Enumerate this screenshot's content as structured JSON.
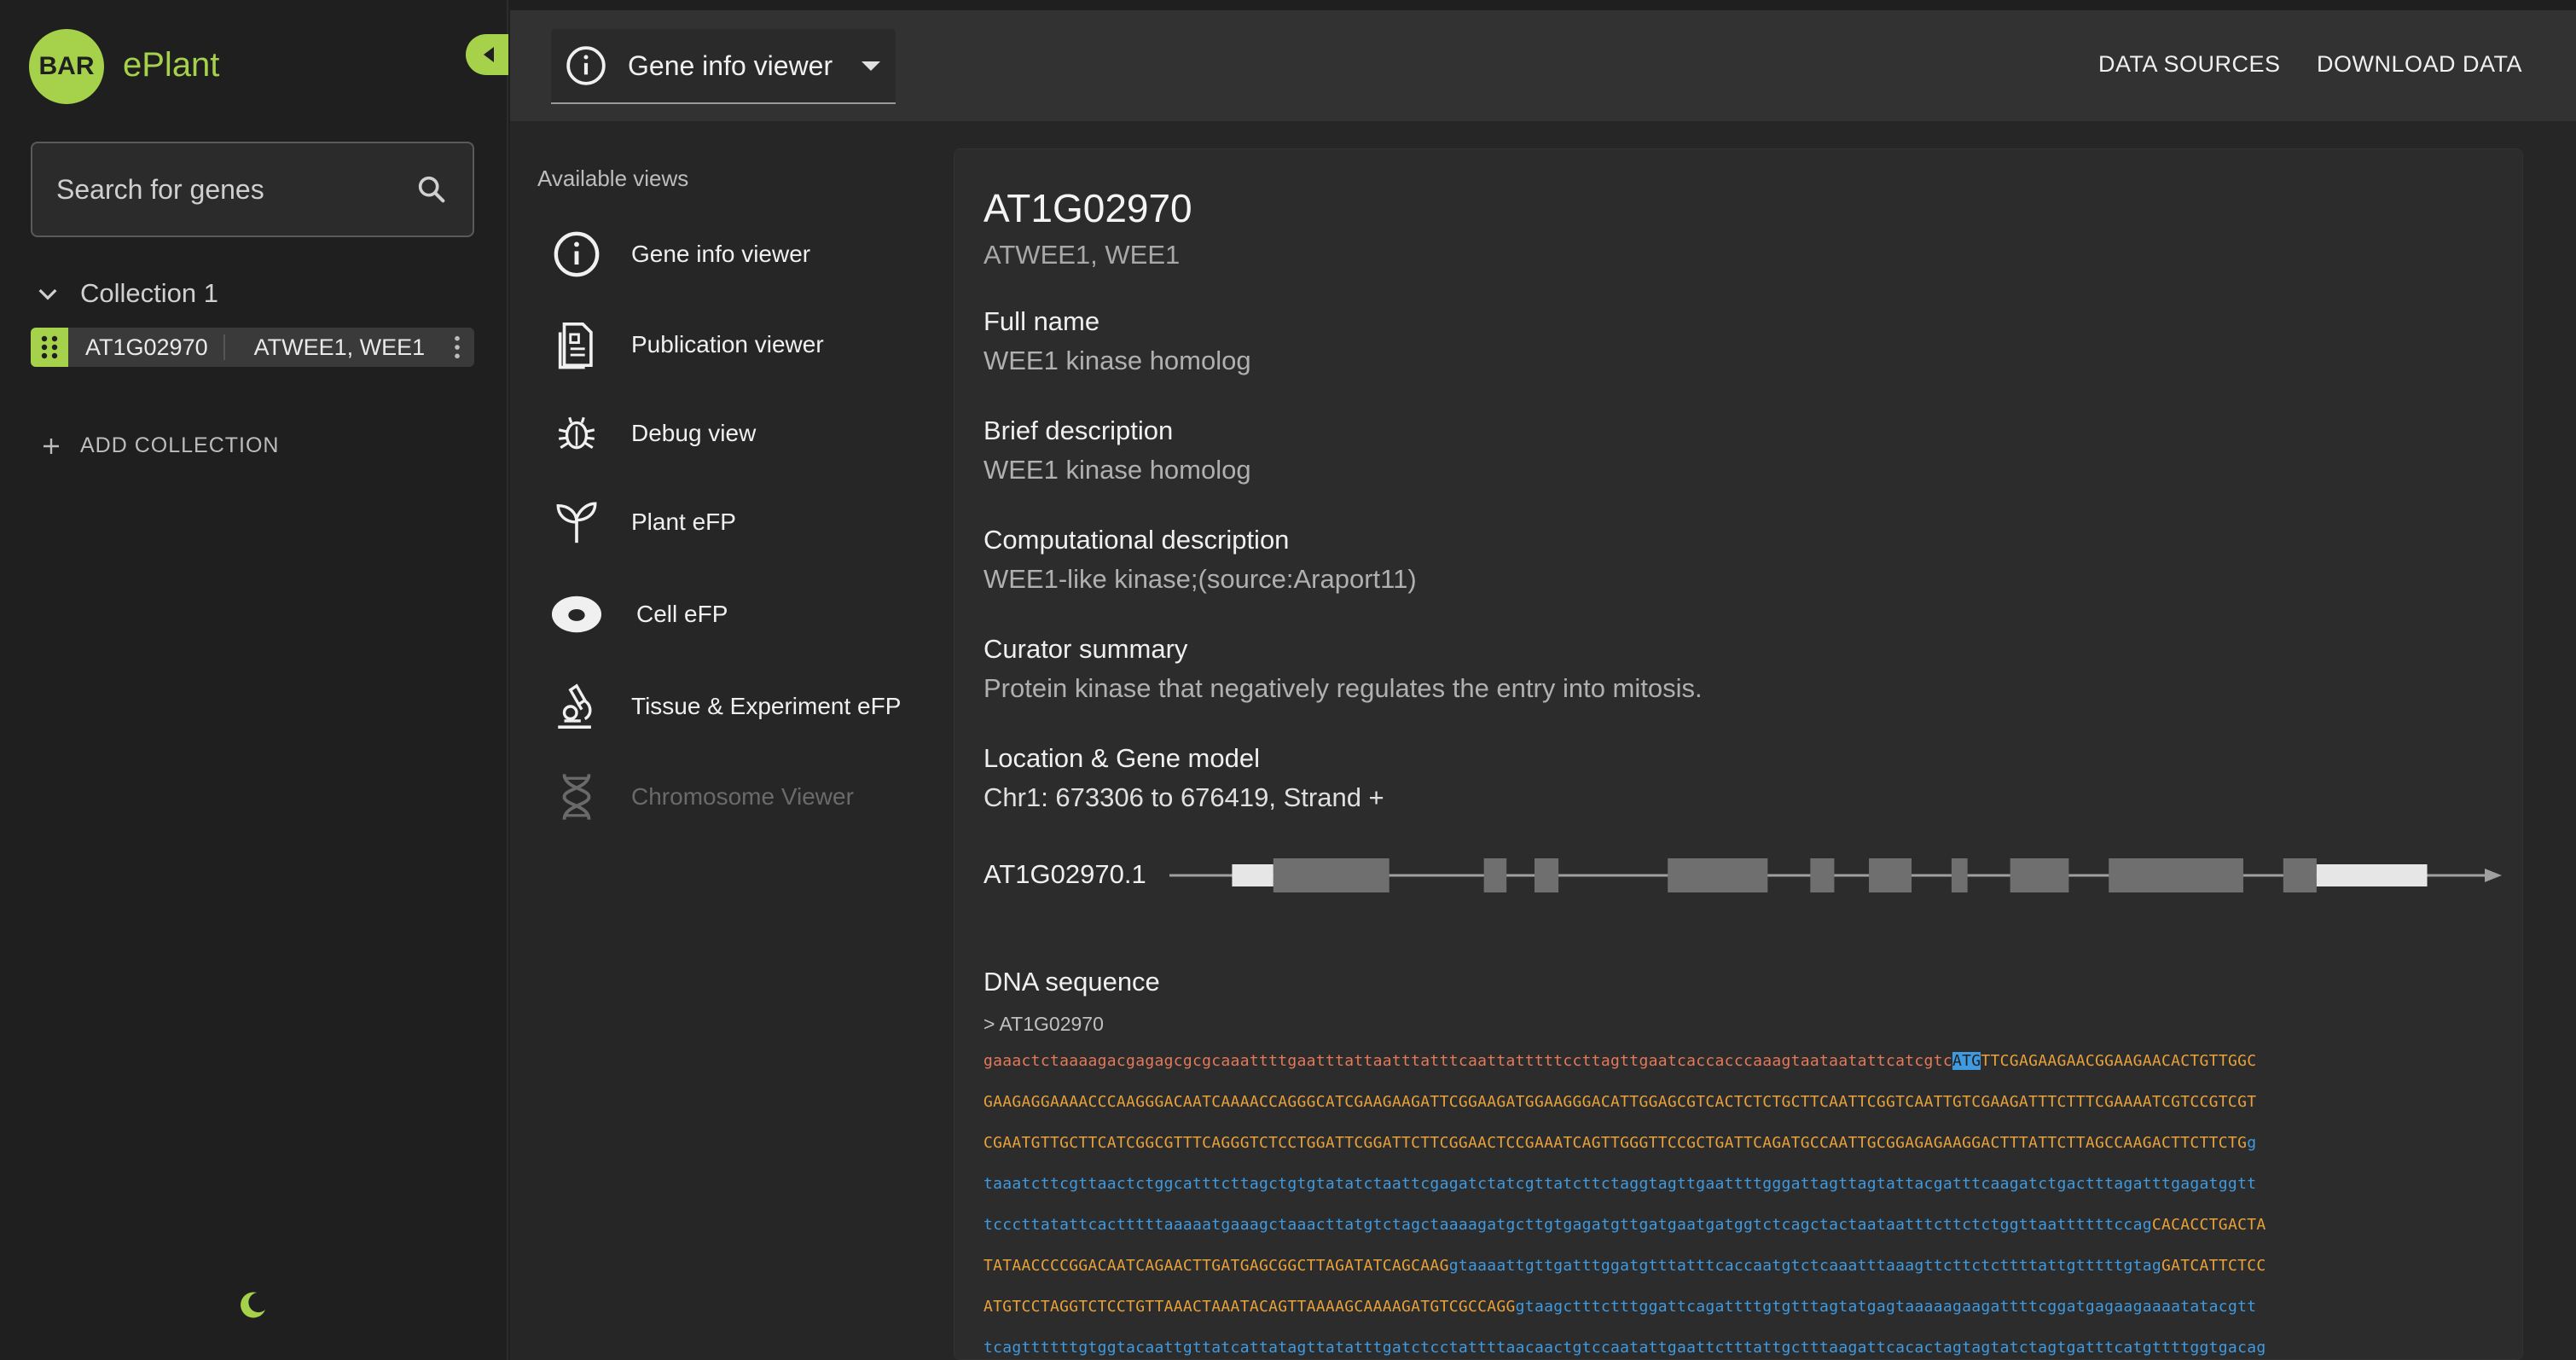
{
  "sidebar": {
    "logo_text": "BAR",
    "app_name": "ePlant",
    "search_placeholder": "Search for genes",
    "collection_name": "Collection 1",
    "gene_id": "AT1G02970",
    "gene_alias": "ATWEE1, WEE1",
    "add_collection_label": "ADD COLLECTION"
  },
  "topbar": {
    "view_selected": "Gene info viewer",
    "data_sources": "DATA SOURCES",
    "download_data": "DOWNLOAD DATA"
  },
  "views": {
    "title": "Available views",
    "items": [
      {
        "label": "Gene info viewer",
        "icon": "info-icon",
        "enabled": true
      },
      {
        "label": "Publication viewer",
        "icon": "document-icon",
        "enabled": true
      },
      {
        "label": "Debug view",
        "icon": "bug-icon",
        "enabled": true
      },
      {
        "label": "Plant eFP",
        "icon": "sprout-icon",
        "enabled": true
      },
      {
        "label": "Cell eFP",
        "icon": "cell-icon",
        "enabled": true
      },
      {
        "label": "Tissue & Experiment eFP",
        "icon": "microscope-icon",
        "enabled": true
      },
      {
        "label": "Chromosome Viewer",
        "icon": "dna-icon",
        "enabled": false
      }
    ]
  },
  "gene": {
    "id": "AT1G02970",
    "aliases": "ATWEE1, WEE1",
    "full_name_label": "Full name",
    "full_name": "WEE1 kinase homolog",
    "brief_label": "Brief description",
    "brief": "WEE1 kinase homolog",
    "computational_label": "Computational description",
    "computational": "WEE1-like kinase;(source:Araport11)",
    "curator_label": "Curator summary",
    "curator": "Protein kinase that negatively regulates the entry into mitosis.",
    "location_label": "Location & Gene model",
    "location": "Chr1: 673306 to 676419, Strand +",
    "model_name": "AT1G02970.1",
    "dna_label": "DNA sequence",
    "fasta_header": "> AT1G02970"
  },
  "sequence_lines": [
    [
      {
        "t": "utr",
        "s": "gaaactctaaaagacgagagcgcgcaaattttgaatttattaatttatttcaattatttttccttagttgaatcaccacccaaagtaataatattcatcgtc"
      },
      {
        "t": "start",
        "s": "ATG"
      },
      {
        "t": "exon",
        "s": "TTCGAGAAGAACGGAAGAACACTGTTGGC"
      }
    ],
    [
      {
        "t": "exon",
        "s": "GAAGAGGAAAACCCAAGGGACAATCAAAACCAGGGCATCGAAGAAGATTCGGAAGATGGAAGGGACATTGGAGCGTCACTCTCTGCTTCAATTCGGTCAATTGTCGAAGATTTCTTTCGAAAATCGTCCGTCGT"
      }
    ],
    [
      {
        "t": "exon",
        "s": "CGAATGTTGCTTCATCGGCGTTTCAGGGTCTCCTGGATTCGGATTCTTCGGAACTCCGAAATCAGTTGGGTTCCGCTGATTCAGATGCCAATTGCGGAGAGAAGGACTTTATTCTTAGCCAAGACTTCTTCTG"
      },
      {
        "t": "intron",
        "s": "g"
      }
    ],
    [
      {
        "t": "intron",
        "s": "taaatcttcgttaactctggcatttcttagctgtgtatatctaattcgagatctatcgttatcttctaggtagttgaattttgggattagttagtattacgatttcaagatctgactttagatttgagatggtt"
      }
    ],
    [
      {
        "t": "intron",
        "s": "tcccttatattcactttttaaaaatgaaagctaaacttatgtctagctaaaagatgcttgtgagatgttgatgaatgatggtctcagctactaataatttcttctctggttaattttttccag"
      },
      {
        "t": "exon",
        "s": "CACACCTGACTA"
      }
    ],
    [
      {
        "t": "exon",
        "s": "TATAACCCCGGACAATCAGAACTTGATGAGCGGCTTAGATATCAGCAAG"
      },
      {
        "t": "intron",
        "s": "gtaaaattgttgatttggatgtttatttcaccaatgtctcaaatttaaagttcttctcttttattgtttttgtag"
      },
      {
        "t": "exon",
        "s": "GATCATTCTCC"
      }
    ],
    [
      {
        "t": "exon",
        "s": "ATGTCCTAGGTCTCCTGTTAAACTAAATACAGTTAAAAGCAAAAGATGTCGCCAGG"
      },
      {
        "t": "intron",
        "s": "gtaagctttctttggattcagattttgtgtttagtatgagtaaaaagaagattttcggatgagaagaaaatatacgtt"
      }
    ],
    [
      {
        "t": "intron",
        "s": "tcagttttttgtggtacaattgttatcattatagttatatttgatctcctattttaacaactgtccaatattgaattctttattgctttaagattcacactagtagtatctagtgatttcatgttttggtgacag"
      }
    ]
  ],
  "gene_model": {
    "start": 673306,
    "end": 676419,
    "strand": "+",
    "features": [
      {
        "type": "utr",
        "start": 0.047,
        "end": 0.078
      },
      {
        "type": "cds",
        "start": 0.078,
        "end": 0.165
      },
      {
        "type": "cds",
        "start": 0.236,
        "end": 0.253
      },
      {
        "type": "cds",
        "start": 0.274,
        "end": 0.292
      },
      {
        "type": "cds",
        "start": 0.374,
        "end": 0.449
      },
      {
        "type": "cds",
        "start": 0.481,
        "end": 0.499
      },
      {
        "type": "cds",
        "start": 0.525,
        "end": 0.557
      },
      {
        "type": "cds",
        "start": 0.587,
        "end": 0.599
      },
      {
        "type": "cds",
        "start": 0.631,
        "end": 0.675
      },
      {
        "type": "cds",
        "start": 0.705,
        "end": 0.806
      },
      {
        "type": "cds",
        "start": 0.836,
        "end": 0.861
      },
      {
        "type": "utr",
        "start": 0.861,
        "end": 0.944
      }
    ],
    "colors": {
      "cds": "#6f6f6f",
      "utr": "#e6e6e6",
      "line": "#a0a0a0"
    }
  },
  "colors": {
    "accent": "#a5d24a",
    "utr_text": "#e5795a",
    "exon_text": "#e9a13a",
    "intron_text": "#3f9ae0"
  }
}
